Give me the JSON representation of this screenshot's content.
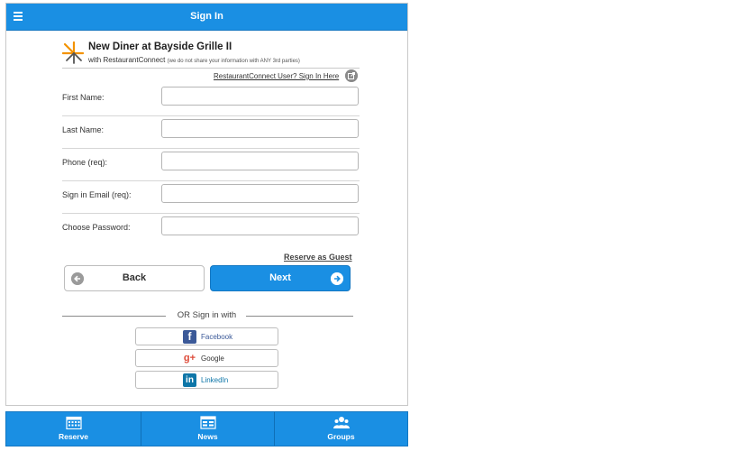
{
  "header": {
    "title": "Sign In",
    "menu_icon": "list-icon"
  },
  "restaurant": {
    "name": "New Diner at Bayside Grille II",
    "with_text": "with RestaurantConnect",
    "privacy_note": "(we do not share your information with ANY 3rd parties)",
    "rc_signin_link": "RestaurantConnect User? Sign In Here",
    "rc_signin_icon": "external-link-icon",
    "logo_icon": "restaurant-connect-logo"
  },
  "form": {
    "fields": [
      {
        "label": "First Name:",
        "value": "",
        "placeholder": ""
      },
      {
        "label": "Last Name:",
        "value": "",
        "placeholder": ""
      },
      {
        "label": "Phone (req):",
        "value": "",
        "placeholder": ""
      },
      {
        "label": "Sign in Email (req):",
        "value": "",
        "placeholder": ""
      },
      {
        "label": "Choose Password:",
        "value": "",
        "placeholder": ""
      }
    ],
    "guest_link": "Reserve as Guest",
    "back_label": "Back",
    "next_label": "Next"
  },
  "social": {
    "divider_text": "OR Sign in with",
    "facebook": "Facebook",
    "google": "Google",
    "linkedin": "LinkedIn"
  },
  "tabs": [
    {
      "label": "Reserve",
      "icon": "calendar-icon"
    },
    {
      "label": "News",
      "icon": "news-icon"
    },
    {
      "label": "Groups",
      "icon": "groups-icon"
    }
  ],
  "colors": {
    "accent": "#1a8fe3",
    "facebook": "#3b5998",
    "google": "#dd4b39",
    "linkedin": "#0e76a8",
    "logo_orange": "#f39200"
  }
}
